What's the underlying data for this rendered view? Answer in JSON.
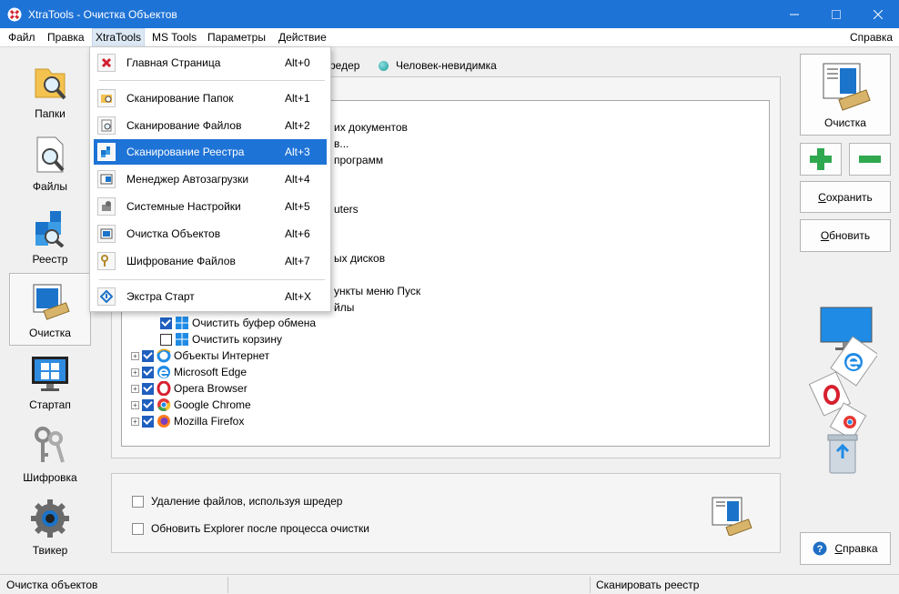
{
  "window": {
    "title": "XtraTools - Очистка Объектов"
  },
  "menu": {
    "items": [
      "Файл",
      "Правка",
      "XtraTools",
      "MS Tools",
      "Параметры",
      "Действие"
    ],
    "help": "Справка"
  },
  "sidebar": {
    "items": [
      {
        "label": "Папки"
      },
      {
        "label": "Файлы"
      },
      {
        "label": "Реестр"
      },
      {
        "label": "Очистка"
      },
      {
        "label": "Стартап"
      },
      {
        "label": "Шифровка"
      },
      {
        "label": "Твикер"
      }
    ]
  },
  "tabs": {
    "partial": "редер",
    "invisible": "Человек-невидимка"
  },
  "tree": {
    "partial": [
      "их документов",
      "в...",
      "программ",
      "uters",
      "ых дисков",
      "ункты меню Пуск",
      "йлы"
    ],
    "items": [
      "Очистить буфер обмена",
      "Очистить корзину",
      "Объекты Интернет",
      "Microsoft Edge",
      "Opera Browser",
      "Google Chrome",
      "Mozilla Firefox"
    ]
  },
  "options": {
    "shredder": "Удаление файлов, используя шредер",
    "refresh_explorer": "Обновить Explorer после процесса очистки"
  },
  "right": {
    "clean": "Очистка",
    "save": "Сохранить",
    "save_u": "С",
    "save_rest": "охранить",
    "refresh_u": "О",
    "refresh_rest": "бновить",
    "help_u": "С",
    "help_rest": "правка"
  },
  "status": {
    "left": "Очистка объектов",
    "right": "Сканировать реестр"
  },
  "dropdown": {
    "items": [
      {
        "label": "Главная Страница",
        "shortcut": "Alt+0"
      },
      {
        "label": "Сканирование Папок",
        "shortcut": "Alt+1"
      },
      {
        "label": "Сканирование Файлов",
        "shortcut": "Alt+2"
      },
      {
        "label": "Сканирование Реестра",
        "shortcut": "Alt+3"
      },
      {
        "label": "Менеджер Автозагрузки",
        "shortcut": "Alt+4"
      },
      {
        "label": "Системные Настройки",
        "shortcut": "Alt+5"
      },
      {
        "label": "Очистка Объектов",
        "shortcut": "Alt+6"
      },
      {
        "label": "Шифрование Файлов",
        "shortcut": "Alt+7"
      },
      {
        "label": "Экстра Старт",
        "shortcut": "Alt+X"
      }
    ]
  },
  "colors": {
    "titlebar": "#1e73d6",
    "highlight": "#1e73d6",
    "add": "#2fa84f",
    "remove": "#2fa84f"
  }
}
